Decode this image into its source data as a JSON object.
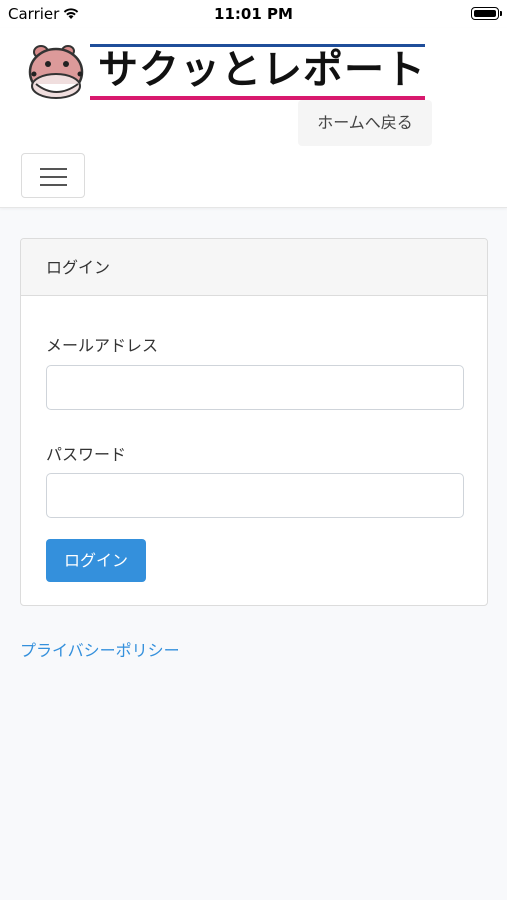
{
  "status_bar": {
    "carrier": "Carrier",
    "time": "11:01 PM"
  },
  "header": {
    "logo_text": "サクッとレポート",
    "home_button": "ホームへ戻る"
  },
  "login_card": {
    "title": "ログイン",
    "email_label": "メールアドレス",
    "email_value": "",
    "password_label": "パスワード",
    "password_value": "",
    "submit_label": "ログイン"
  },
  "footer": {
    "privacy_link": "プライバシーポリシー"
  },
  "colors": {
    "accent": "#3490dc",
    "logo_line_top": "#1f4e9a",
    "logo_line_bottom": "#d8196e",
    "page_background": "#f8f9fb"
  },
  "icons": [
    "wifi-icon",
    "battery-icon",
    "hippo-logo-icon",
    "hamburger-menu-icon"
  ]
}
